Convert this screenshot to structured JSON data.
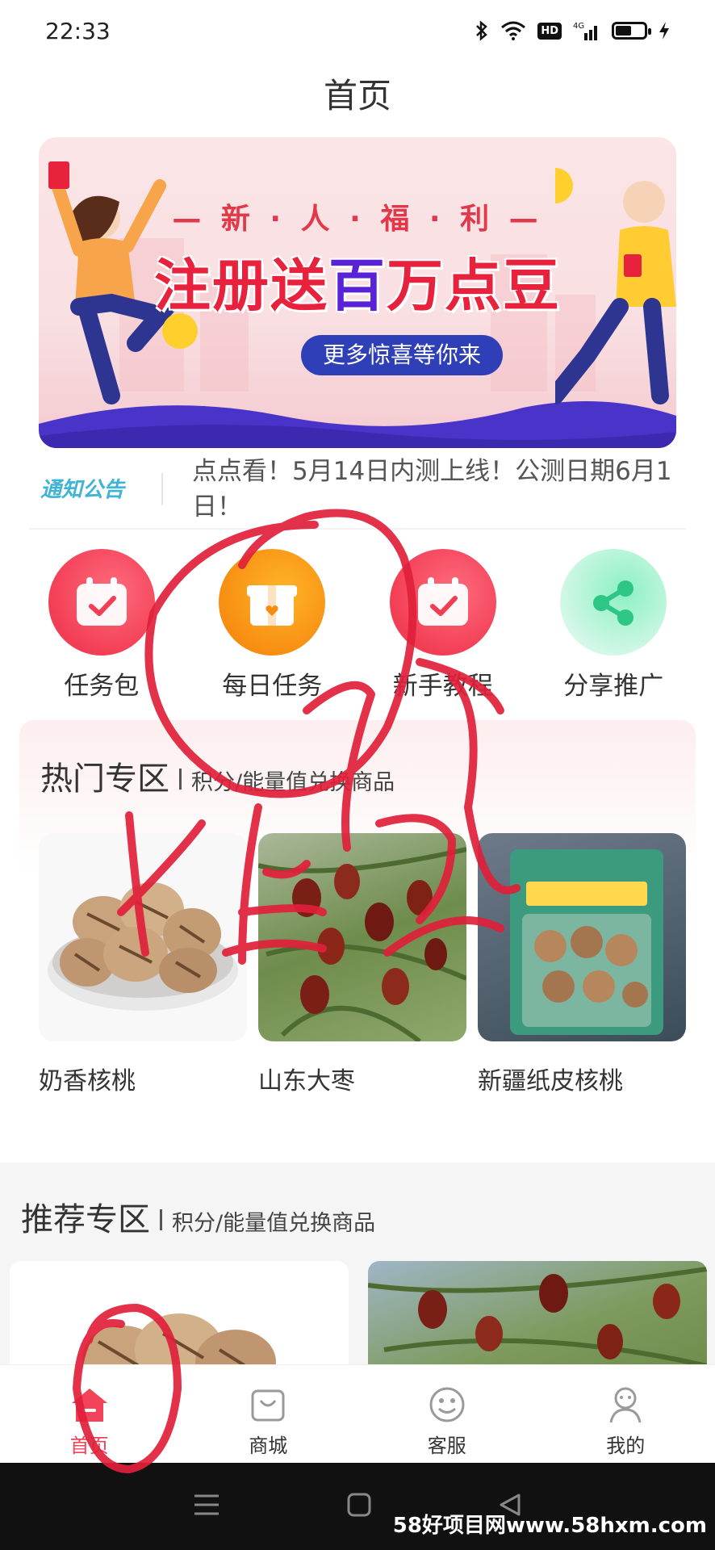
{
  "status_bar": {
    "time": "22:33",
    "hd_label": "HD",
    "network_label": "4G",
    "battery_level": 0.55
  },
  "header": {
    "title": "首页"
  },
  "banner": {
    "subtitle": "— 新 · 人 · 福 · 利 —",
    "headline_part1": "注册送",
    "headline_highlight": "百",
    "headline_part2": "万点豆",
    "cta": "更多惊喜等你来"
  },
  "notice": {
    "logo_text": "通知公告",
    "text": "点点看！5月14日内测上线！公测日期6月1日！"
  },
  "features": [
    {
      "label": "任务包",
      "icon": "calendar-check-icon"
    },
    {
      "label": "每日任务",
      "icon": "gift-box-icon"
    },
    {
      "label": "新手教程",
      "icon": "calendar-check-icon"
    },
    {
      "label": "分享推广",
      "icon": "share-icon"
    }
  ],
  "hot_zone": {
    "title": "热门专区",
    "subtitle": "积分/能量值兑换商品",
    "products": [
      {
        "name": "奶香核桃"
      },
      {
        "name": "山东大枣"
      },
      {
        "name": "新疆纸皮核桃"
      }
    ]
  },
  "recommend_zone": {
    "title": "推荐专区",
    "subtitle": "积分/能量值兑换商品"
  },
  "tabbar": {
    "items": [
      {
        "label": "首页",
        "icon": "home-icon",
        "active": true
      },
      {
        "label": "商城",
        "icon": "shopping-bag-icon",
        "active": false
      },
      {
        "label": "客服",
        "icon": "smiley-icon",
        "active": false
      },
      {
        "label": "我的",
        "icon": "user-icon",
        "active": false
      }
    ]
  },
  "watermark": "58好项目网www.58hxm.com",
  "colors": {
    "accent_red": "#f2435a",
    "orange": "#f78b10",
    "green": "#3ecf8e",
    "banner_blue": "#2f3fb8",
    "scribble": "#e0203a"
  }
}
